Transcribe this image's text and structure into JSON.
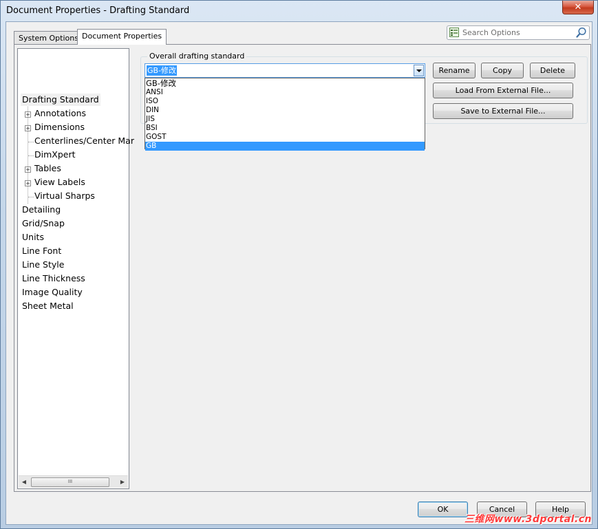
{
  "window": {
    "title": "Document Properties - Drafting Standard",
    "close_label": "✕"
  },
  "tabs": [
    {
      "label": "System Options"
    },
    {
      "label": "Document Properties"
    }
  ],
  "search": {
    "placeholder": "Search Options"
  },
  "tree": {
    "items": [
      {
        "label": "Drafting Standard"
      },
      {
        "label": "Annotations"
      },
      {
        "label": "Dimensions"
      },
      {
        "label": "Centerlines/Center Mar"
      },
      {
        "label": "DimXpert"
      },
      {
        "label": "Tables"
      },
      {
        "label": "View Labels"
      },
      {
        "label": "Virtual Sharps"
      },
      {
        "label": "Detailing"
      },
      {
        "label": "Grid/Snap"
      },
      {
        "label": "Units"
      },
      {
        "label": "Line Font"
      },
      {
        "label": "Line Style"
      },
      {
        "label": "Line Thickness"
      },
      {
        "label": "Image Quality"
      },
      {
        "label": "Sheet Metal"
      }
    ],
    "scroll_thumb": "III"
  },
  "standard": {
    "group_label": "Overall drafting standard",
    "selected": "GB-修改",
    "options": [
      "GB-修改",
      "ANSI",
      "ISO",
      "DIN",
      "JIS",
      "BSI",
      "GOST",
      "GB"
    ],
    "highlighted": "GB"
  },
  "buttons": {
    "rename": "Rename",
    "copy": "Copy",
    "delete": "Delete",
    "load": "Load From External File...",
    "save": "Save to External File...",
    "ok": "OK",
    "cancel": "Cancel",
    "help": "Help"
  },
  "watermark": "三维网www.3dportal.cn",
  "colors": {
    "selection": "#3399ff",
    "close": "#c23a1e",
    "watermark": "#ff3b3b"
  }
}
